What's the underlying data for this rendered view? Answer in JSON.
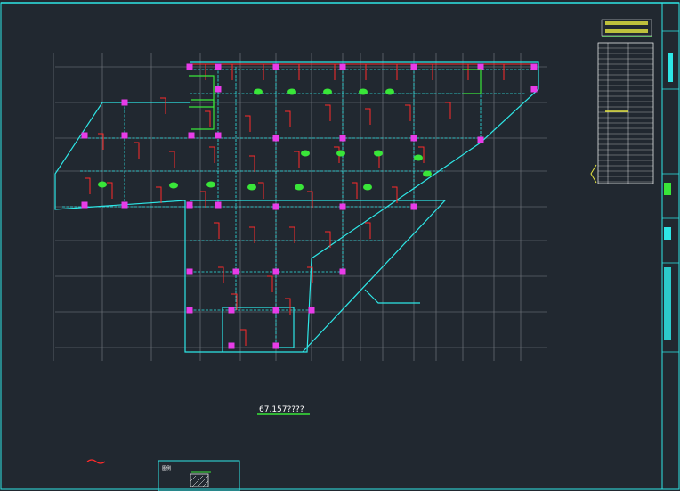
{
  "drawing": {
    "elevation_label": "67.157????",
    "legend_box_label": "图例"
  },
  "colors": {
    "background": "#212830",
    "border": "#2ee6e6",
    "grid": "#7a7f86",
    "beam": "#2ee6e6",
    "rebar": "#ff2a2a",
    "column": "#e83ce8",
    "tag": "#39e639",
    "text": "#ffffff"
  },
  "icons": {
    "section_mark": "wave-symbol",
    "hatch": "hatched-rectangle"
  }
}
